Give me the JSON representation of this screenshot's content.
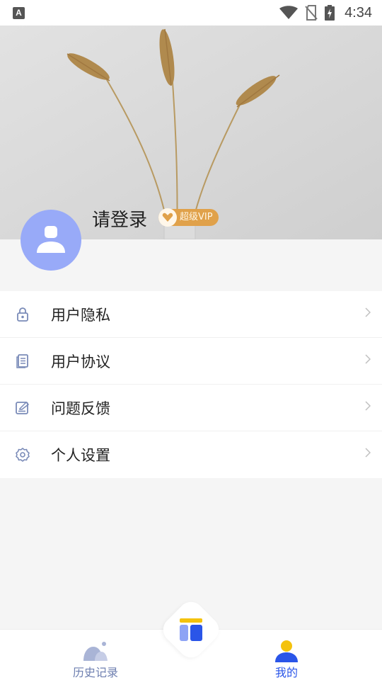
{
  "status_bar": {
    "app_letter": "A",
    "time": "4:34"
  },
  "profile": {
    "login_text": "请登录",
    "vip_label": "超级VIP"
  },
  "menu": {
    "items": [
      {
        "label": "用户隐私",
        "icon": "lock-icon"
      },
      {
        "label": "用户协议",
        "icon": "document-icon"
      },
      {
        "label": "问题反馈",
        "icon": "feedback-icon"
      },
      {
        "label": "个人设置",
        "icon": "gear-icon"
      }
    ]
  },
  "bottom_nav": {
    "history_label": "历史记录",
    "mine_label": "我的",
    "active": "mine"
  },
  "colors": {
    "accent": "#2a55e8",
    "avatar": "#98aaf8",
    "vip": "#e0a14a",
    "inactive_nav": "#6e7fb0"
  }
}
